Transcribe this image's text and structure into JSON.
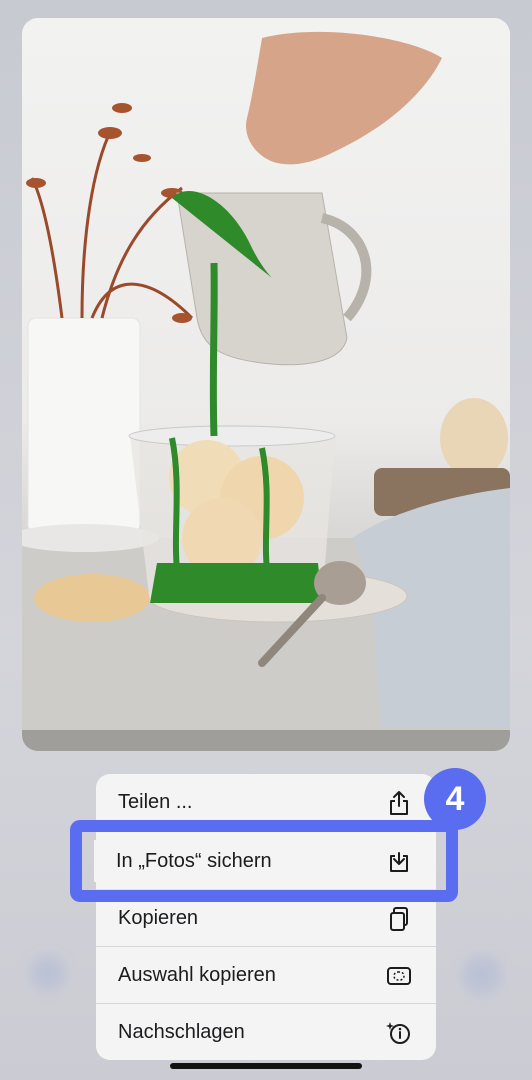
{
  "menu": {
    "items": [
      {
        "label": "Teilen ...",
        "icon": "share-icon"
      },
      {
        "label": "In „Fotos“ sichern",
        "icon": "save-to-photos-icon"
      },
      {
        "label": "Kopieren",
        "icon": "copy-icon"
      },
      {
        "label": "Auswahl kopieren",
        "icon": "select-copy-icon"
      },
      {
        "label": "Nachschlagen",
        "icon": "look-up-icon"
      }
    ]
  },
  "callout": {
    "step_number": "4",
    "color": "#5a6cf0"
  },
  "photo": {
    "subject": "pouring green sauce over ice cream in glass"
  }
}
